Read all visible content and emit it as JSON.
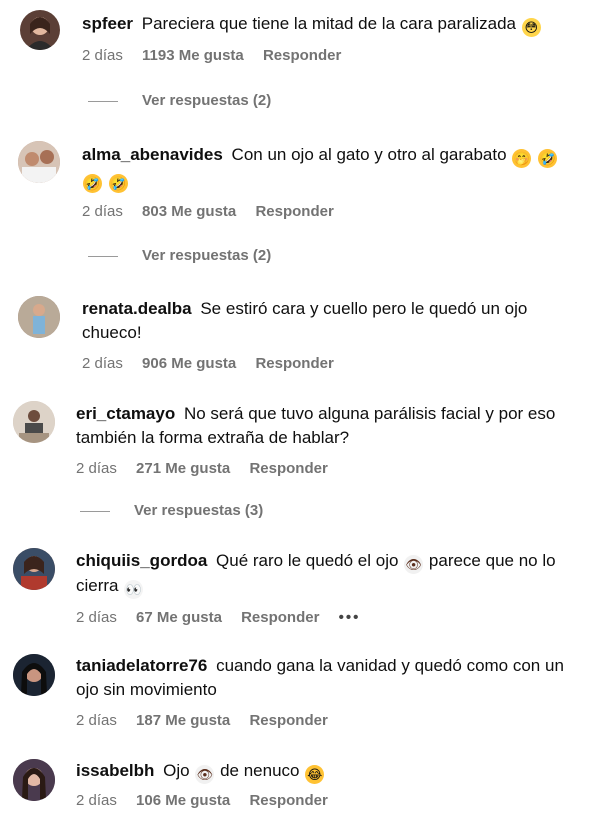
{
  "comments": [
    {
      "username": "spfeer",
      "text": "Pareciera que tiene la mitad de la cara paralizada",
      "emoji": [
        "😳"
      ],
      "time": "2 días",
      "likes": "1193 Me gusta",
      "reply": "Responder",
      "view_replies": "Ver respuestas (2)",
      "avatar_color": "#5b3f36"
    },
    {
      "username": "alma_abenavides",
      "text": "Con un ojo al gato y otro al garabato",
      "emoji": [
        "🤭",
        "🤣",
        "🤣",
        "🤣"
      ],
      "time": "2 días",
      "likes": "803 Me gusta",
      "reply": "Responder",
      "view_replies": "Ver respuestas (2)",
      "avatar_color": "#b68f7a"
    },
    {
      "username": "renata.dealba",
      "text": "Se estiró cara y cuello pero le quedó un ojo chueco!",
      "emoji": [],
      "time": "2 días",
      "likes": "906 Me gusta",
      "reply": "Responder",
      "avatar_color": "#8c6c58"
    },
    {
      "username": "eri_ctamayo",
      "text": "No será que tuvo alguna parálisis facial y por eso también la forma extraña de hablar?",
      "emoji": [],
      "time": "2 días",
      "likes": "271 Me gusta",
      "reply": "Responder",
      "view_replies": "Ver respuestas (3)",
      "avatar_color": "#c9b9a8"
    },
    {
      "username": "chiquiis_gordoa",
      "text_before": "Qué raro le quedó el ojo",
      "text_after": "parece que no lo cierra",
      "emoji_mid": "👁",
      "emoji": [
        "👀"
      ],
      "time": "2 días",
      "likes": "67 Me gusta",
      "reply": "Responder",
      "more": "•••",
      "avatar_color": "#7a4a3a"
    },
    {
      "username": "taniadelatorre76",
      "text": "cuando gana la vanidad y quedó como con un ojo sin movimiento",
      "emoji": [],
      "time": "2 días",
      "likes": "187 Me gusta",
      "reply": "Responder",
      "avatar_color": "#1f2a3a"
    },
    {
      "username": "issabelbh",
      "text_before": "Ojo",
      "text_after": "de nenuco",
      "emoji_mid": "👁",
      "emoji": [
        "😂"
      ],
      "time": "2 días",
      "likes": "106 Me gusta",
      "reply": "Responder",
      "avatar_color": "#3a2b3c"
    }
  ]
}
